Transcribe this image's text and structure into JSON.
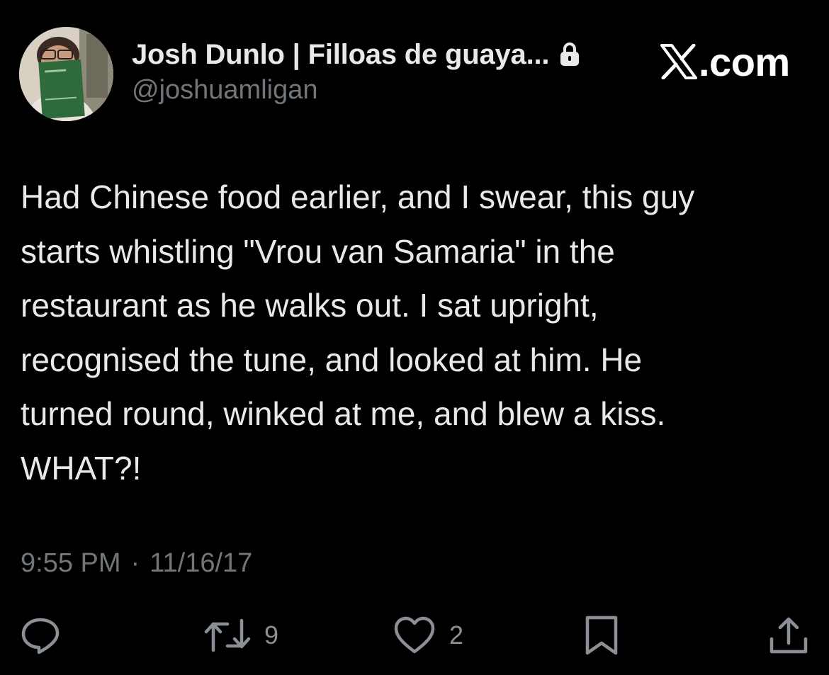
{
  "author": {
    "display_name": "Josh Dunlo | Filloas de guaya...",
    "handle": "@joshuamligan",
    "avatar_icon": "profile-photo-holding-green-book",
    "protected_icon": "lock-icon"
  },
  "brand": {
    "icon": "x-logo-icon",
    "text": ".com"
  },
  "tweet": {
    "text": "Had Chinese food earlier, and I swear, this guy\nstarts whistling \"Vrou van Samaria\" in the\nrestaurant as he walks out. I sat upright,\nrecognised the tune, and looked at him. He\nturned round, winked at me, and blew a kiss.\nWHAT?!",
    "time": "9:55 PM",
    "separator": "·",
    "date": "11/16/17"
  },
  "actions": {
    "reply": {
      "icon": "reply-icon"
    },
    "retweet": {
      "icon": "retweet-icon",
      "count": "9"
    },
    "like": {
      "icon": "heart-icon",
      "count": "2"
    },
    "bookmark": {
      "icon": "bookmark-icon"
    },
    "share": {
      "icon": "share-icon"
    }
  },
  "colors": {
    "background": "#000000",
    "primary_text": "#e7e9ea",
    "secondary_text": "#71767b",
    "icon": "#8b9096"
  }
}
